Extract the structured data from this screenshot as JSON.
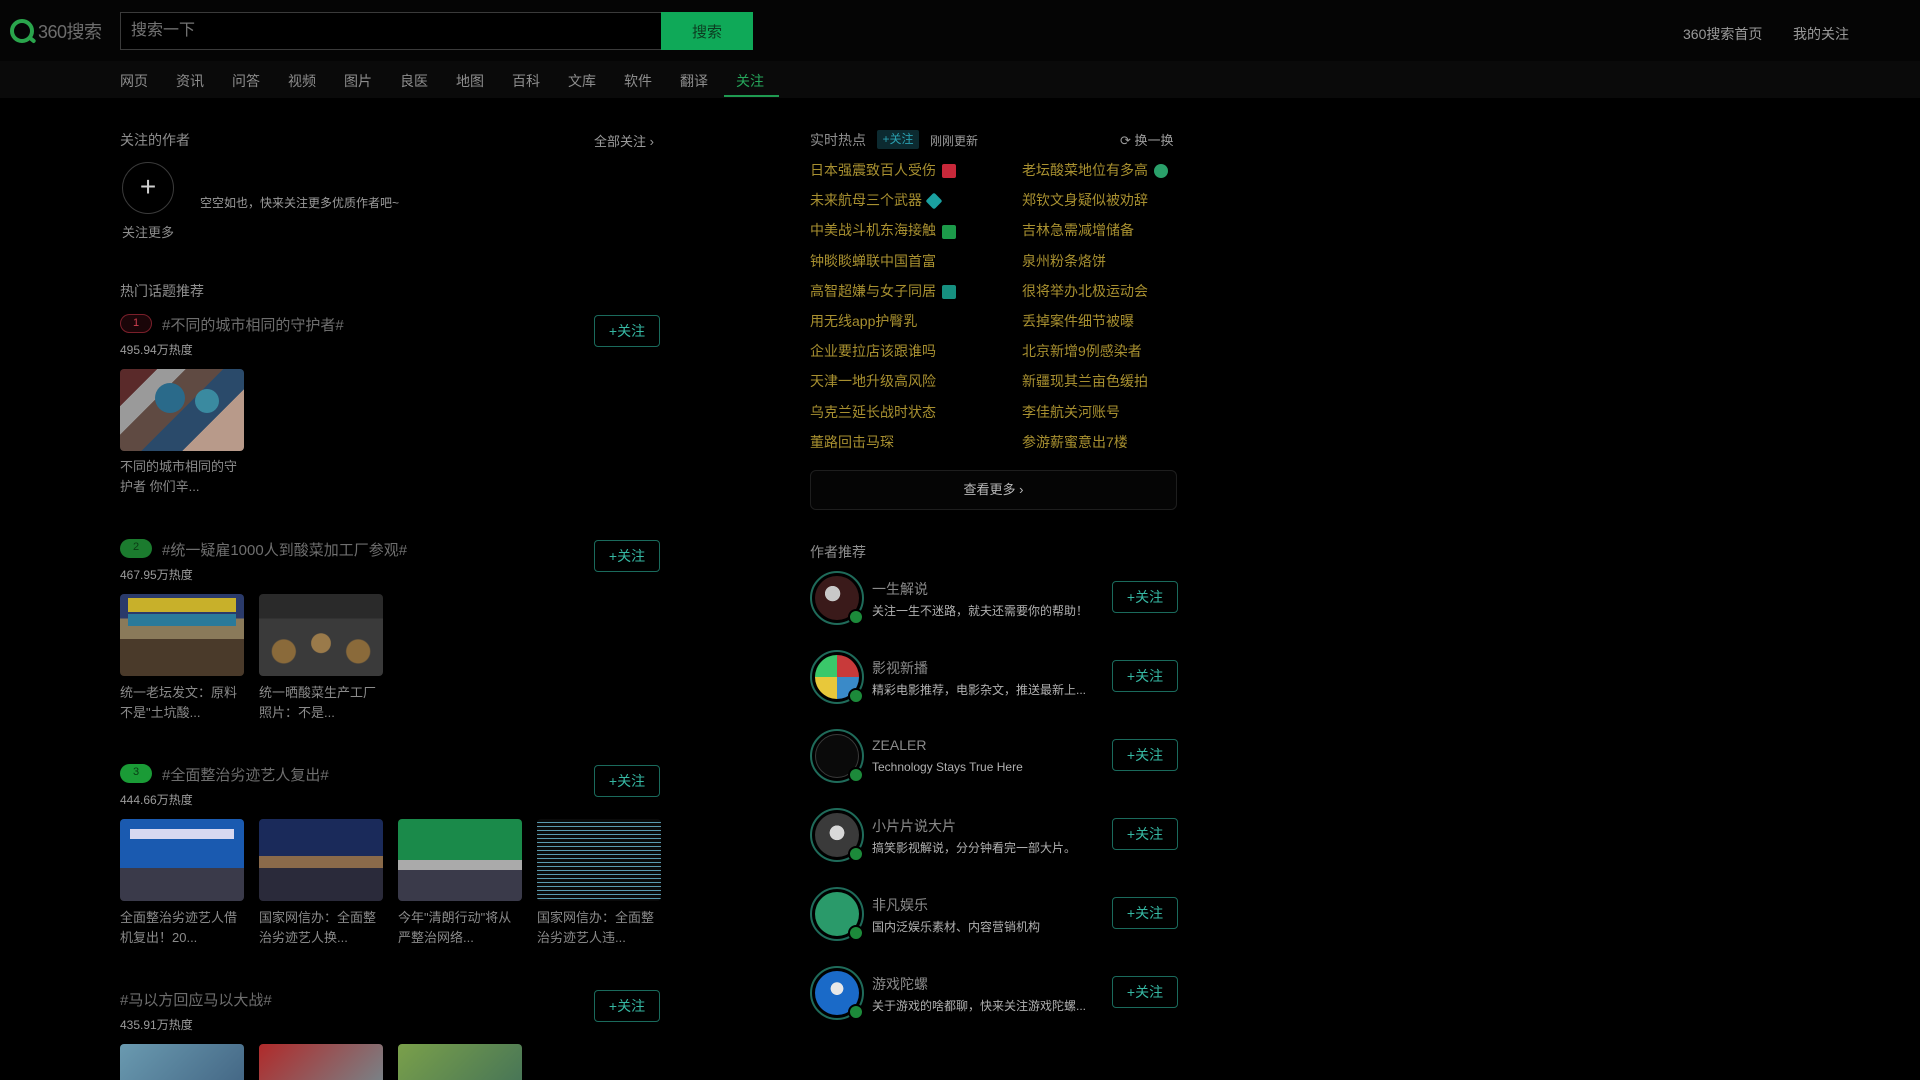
{
  "header": {
    "logo_text": "360搜索",
    "search_placeholder": "搜索一下",
    "search_button": "搜索",
    "link_home": "360搜索首页",
    "link_follow": "我的关注"
  },
  "nav": {
    "items": [
      "网页",
      "资讯",
      "问答",
      "视频",
      "图片",
      "良医",
      "地图",
      "百科",
      "文库",
      "软件",
      "翻译",
      "关注"
    ],
    "active_index": 11
  },
  "followed_authors": {
    "title": "关注的作者",
    "all_link": "全部关注",
    "add_symbol": "+",
    "add_label": "关注更多",
    "empty_text": "空空如也，快来关注更多优质作者吧~"
  },
  "hot_topics": {
    "title": "热门话题推荐",
    "follow_label": "+关注",
    "topics": [
      {
        "rank": "1",
        "title": "#不同的城市相同的守护者#",
        "heat": "495.94万热度",
        "items": [
          {
            "caption": "不同的城市相同的守护者 你们辛..."
          }
        ]
      },
      {
        "rank": "2",
        "title": "#统一疑雇1000人到酸菜加工厂参观#",
        "heat": "467.95万热度",
        "items": [
          {
            "caption": "统一老坛发文：原料不是\"土坑酸..."
          },
          {
            "caption": "统一晒酸菜生产工厂照片：不是..."
          }
        ]
      },
      {
        "rank": "3",
        "title": "#全面整治劣迹艺人复出#",
        "heat": "444.66万热度",
        "items": [
          {
            "caption": "全面整治劣迹艺人借机复出！20..."
          },
          {
            "caption": "国家网信办：全面整治劣迹艺人换..."
          },
          {
            "caption": "今年\"清朗行动\"将从严整治网络..."
          },
          {
            "caption": "国家网信办：全面整治劣迹艺人违..."
          }
        ]
      },
      {
        "rank": "",
        "title": "#马以方回应马以大战#",
        "heat": "435.91万热度",
        "items": []
      }
    ]
  },
  "realtime": {
    "title": "实时热点",
    "badge": "+关注",
    "updated": "刚刚更新",
    "refresh": "换一换",
    "left": [
      {
        "text": "日本强震致百人受伤",
        "tag": "red"
      },
      {
        "text": "未来航母三个武器",
        "tag": "diamond"
      },
      {
        "text": "中美战斗机东海接触",
        "tag": "green"
      },
      {
        "text": "钟睒睒蝉联中国首富",
        "tag": ""
      },
      {
        "text": "高智超嫌与女子同居",
        "tag": "teal"
      },
      {
        "text": "用无线app护臀乳",
        "tag": ""
      },
      {
        "text": "企业要拉店该跟谁吗",
        "tag": ""
      },
      {
        "text": "天津一地升级高风险",
        "tag": ""
      },
      {
        "text": "乌克兰延长战时状态",
        "tag": ""
      },
      {
        "text": "董路回击马琛",
        "tag": ""
      }
    ],
    "right": [
      {
        "text": "老坛酸菜地位有多高",
        "tag": "globe"
      },
      {
        "text": "郑钦文身疑似被劝辞",
        "tag": ""
      },
      {
        "text": "吉林急需减增储备",
        "tag": ""
      },
      {
        "text": "泉州粉条烙饼",
        "tag": ""
      },
      {
        "text": "很将举办北极运动会",
        "tag": ""
      },
      {
        "text": "丢掉案件细节被曝",
        "tag": ""
      },
      {
        "text": "北京新增9例感染者",
        "tag": ""
      },
      {
        "text": "新疆现其兰亩色缓拍",
        "tag": ""
      },
      {
        "text": "李佳航关河账号",
        "tag": ""
      },
      {
        "text": "参游薪蜜意出7楼",
        "tag": ""
      }
    ],
    "view_more": "查看更多"
  },
  "author_recommend": {
    "title": "作者推荐",
    "follow_label": "+关注",
    "authors": [
      {
        "name": "一生解说",
        "desc": "关注一生不迷路，就夫还需要你的帮助！"
      },
      {
        "name": "影视新播",
        "desc": "精彩电影推荐，电影杂文，推送最新上..."
      },
      {
        "name": "ZEALER",
        "desc": "Technology Stays True Here"
      },
      {
        "name": "小片片说大片",
        "desc": "搞笑影视解说，分分钟看完一部大片。"
      },
      {
        "name": "非凡娱乐",
        "desc": "国内泛娱乐素材、内容营销机构"
      },
      {
        "name": "游戏陀螺",
        "desc": "关于游戏的啥都聊，快来关注游戏陀螺..."
      }
    ]
  }
}
